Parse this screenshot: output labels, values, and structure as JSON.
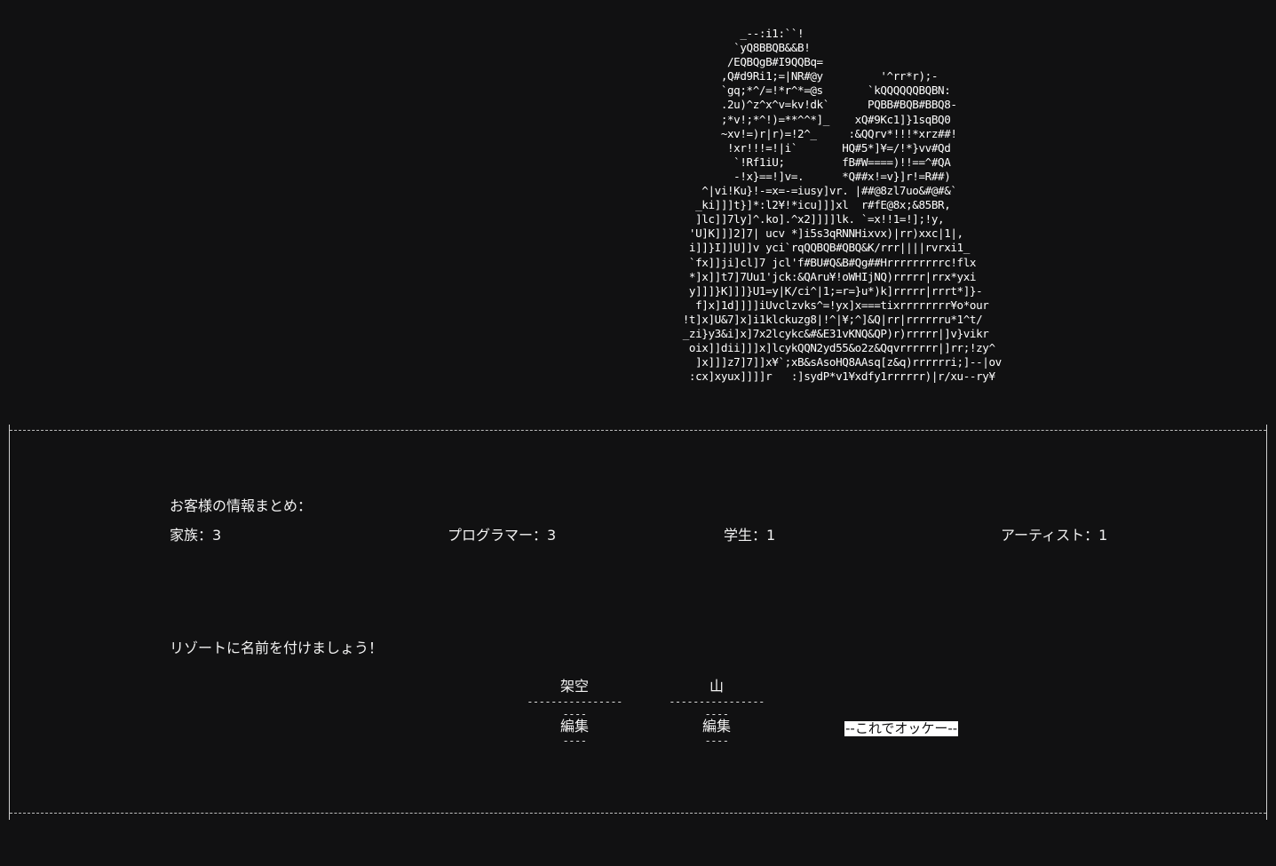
{
  "ascii_art": "             _--:i1:``!\n            `yQ8BBQB&&B!\n           /EQBQgB#I9QQBq=\n          ,Q#d9Ri1;=|NR#@y         '^rr*r);-\n          `gq;*^/=!*r^*=@s       `kQQQQQQBQBN:\n          .2u)^z^x^v=kv!dk`      PQBB#BQB#BBQ8-\n          ;*v!;*^!)=**^^*]_    xQ#9Kc1]}1sqBQ0\n          ~xv!=)r|r)=!2^_     :&QQrv*!!!*xrz##!\n           !xr!!!=!|i`       HQ#5*]¥=/!*}vv#Qd\n            `!Rf1iU;         fB#W====)!!==^#QA\n            -!x}==!]v=.      *Q##x!=v}]r!=R##)\n       ^|vi!Ku}!-=x=-=iusy]vr. |##@8zl7uo&#@#&`\n      _ki]]]t}]*:l2¥!*icu]]]xl  r#fE@8x;&85BR,\n      ]lc]]7ly]^.ko].^x2]]]]lk. `=x!!1=!];!y,\n     'U]K]]]2]7| ucv *]i5s3qRNNHixvx)|rr)xxc|1|,\n     i]]}I]]U]]v yci`rqQQBQB#QBQ&K/rrr||||rvrxi1_\n     `fx]]ji]cl]7 jcl'f#BU#Q&B#Qg##Hrrrrrrrrrc!flx\n     *]x]]t7]7Uu1'jck:&QAru¥!oWHIjNQ)rrrrr|rrx*yxi\n     y]]]}K]]]}U1=y|K/ci^|1;=r=}u*)k]rrrrr|rrrt*]}-\n      f]x]1d]]]]iUvclzvks^=!yx]x===tixrrrrrrrr¥o*our\n    !t]x]U&7]x]i1klckuzg8|!^|¥;^]&Q|rr|rrrrrru*1^t/\n    _zi}y3&i]x]7x2lcykc&#&E31vKNQ&QP)r)rrrrr|]v}vikr\n     oix]]dii]]]x]lcykQQN2yd55&o2z&Qqvrrrrrr|]rr;!zy^\n      ]x]]]z7]7]]x¥`;xB&sAsoHQ8AAsq[z&q)rrrrrri;]--|ov\n     :cx]xyux]]]]r   :]sydP*v1¥xdfy1rrrrrr)|r/xu--ry¥",
  "summary": {
    "heading": "お客様の情報まとめ：",
    "family": "家族：3",
    "programmer": "プログラマー：3",
    "student": "学生：1",
    "artist": "アーティスト：1"
  },
  "naming": {
    "prompt": "リゾートに名前を付けましょう！",
    "rule_long": "----------------",
    "rule_short": "----",
    "slots": [
      {
        "word": "架空",
        "edit_label": "編集"
      },
      {
        "word": "山",
        "edit_label": "編集"
      }
    ],
    "confirm_label": "--これでオッケー--"
  }
}
